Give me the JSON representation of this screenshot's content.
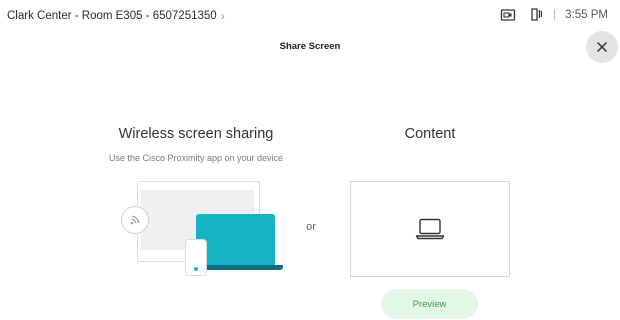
{
  "header": {
    "room_info": "Clark Center - Room E305 - 6507251350",
    "chevron": "›",
    "separator": "|",
    "time": "3:55 PM",
    "icons": [
      "camera-monitor-icon",
      "touch-controller-icon"
    ]
  },
  "dialog": {
    "title": "Share Screen",
    "close_icon": "close-icon"
  },
  "wireless": {
    "title": "Wireless screen sharing",
    "subtitle": "Use the Cisco Proximity app on your device",
    "illustration_icons": [
      "wireless-signal-icon",
      "laptop-illustration",
      "phone-illustration"
    ]
  },
  "or_label": "or",
  "content": {
    "title": "Content",
    "icon": "laptop-icon",
    "preview_label": "Preview"
  },
  "colors": {
    "accent_cyan": "#14b4c6",
    "accent_dark": "#0e6f83",
    "preview_bg": "#e3f7e6",
    "preview_text": "#3e9b59",
    "close_bg": "#e4e4e4"
  }
}
